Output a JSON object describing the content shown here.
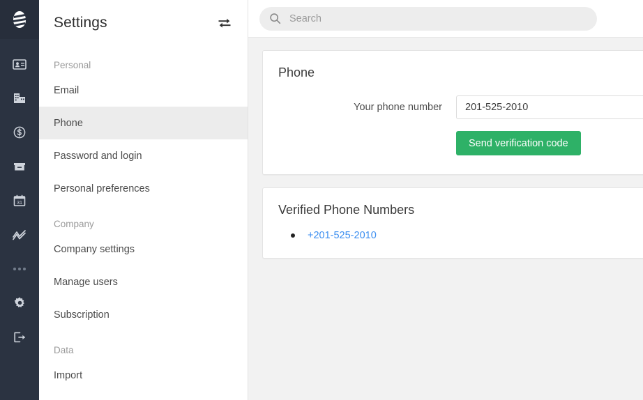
{
  "rail": {
    "logo": {
      "name": "app-logo",
      "icon": "striped-egg-logo"
    },
    "items": [
      {
        "icon": "contact-card-icon",
        "name": "rail-item-contacts"
      },
      {
        "icon": "building-icon",
        "name": "rail-item-companies"
      },
      {
        "icon": "dollar-circle-icon",
        "name": "rail-item-deals"
      },
      {
        "icon": "archive-box-icon",
        "name": "rail-item-inbox"
      },
      {
        "icon": "calendar-31-icon",
        "name": "rail-item-calendar"
      },
      {
        "icon": "line-chart-icon",
        "name": "rail-item-reports"
      },
      {
        "icon": "ellipsis-icon",
        "name": "rail-item-more"
      },
      {
        "icon": "gear-icon",
        "name": "rail-item-settings"
      },
      {
        "icon": "logout-icon",
        "name": "rail-item-logout"
      }
    ]
  },
  "sidebar": {
    "title": "Settings",
    "swap_icon": "swap-arrows-icon",
    "groups": [
      {
        "label": "Personal",
        "items": [
          {
            "label": "Email",
            "active": false
          },
          {
            "label": "Phone",
            "active": true
          },
          {
            "label": "Password and login",
            "active": false
          },
          {
            "label": "Personal preferences",
            "active": false
          }
        ]
      },
      {
        "label": "Company",
        "items": [
          {
            "label": "Company settings",
            "active": false
          },
          {
            "label": "Manage users",
            "active": false
          },
          {
            "label": "Subscription",
            "active": false
          }
        ]
      },
      {
        "label": "Data",
        "items": [
          {
            "label": "Import",
            "active": false
          }
        ]
      }
    ]
  },
  "topbar": {
    "search": {
      "placeholder": "Search",
      "value": "",
      "icon": "search-icon"
    }
  },
  "main": {
    "phone_card": {
      "title": "Phone",
      "field_label": "Your phone number",
      "field_value": "201-525-2010",
      "field_placeholder": "",
      "button_label": "Send verification code"
    },
    "verified_card": {
      "title": "Verified Phone Numbers",
      "numbers": [
        {
          "label": "+201-525-2010"
        }
      ]
    }
  },
  "colors": {
    "rail_bg": "#2b3341",
    "rail_logo_bg": "#272e3b",
    "accent_green": "#2eb167",
    "link_blue": "#3b8ef0",
    "active_row": "#ececec",
    "content_bg": "#f2f2f2"
  }
}
